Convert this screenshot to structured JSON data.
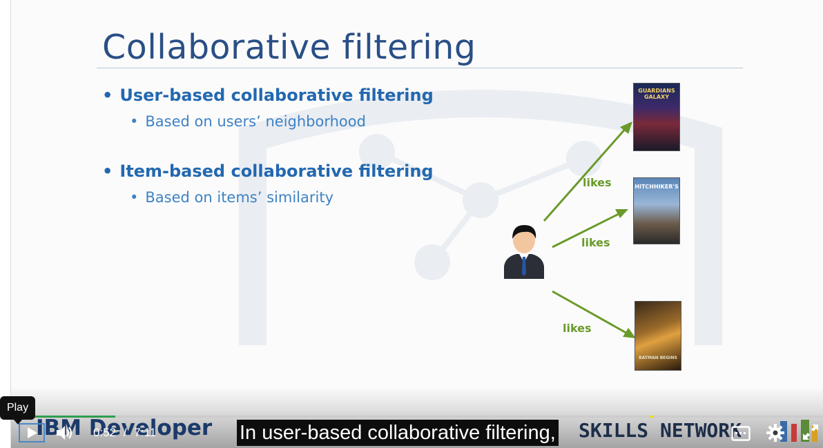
{
  "slide": {
    "title": "Collaborative filtering",
    "bullets": [
      {
        "level": 1,
        "text": "User-based collaborative filtering"
      },
      {
        "level": 2,
        "text": "Based on users’ neighborhood"
      },
      {
        "level": 1,
        "text": "Item-based collaborative filtering"
      },
      {
        "level": 2,
        "text": "Based on items’ similarity"
      }
    ],
    "arrow_labels": [
      "likes",
      "likes",
      "likes"
    ],
    "posters": [
      {
        "text": "GUARDIANS GALAXY",
        "icon": "movie-poster-icon"
      },
      {
        "text": "HITCHHIKER'S",
        "icon": "movie-poster-icon"
      },
      {
        "text": "BATMAN BEGINS",
        "icon": "movie-poster-icon"
      }
    ]
  },
  "player": {
    "tooltip": "Play",
    "current_time": "0:52",
    "separator": "/",
    "duration": "7:11",
    "progress": 0.128,
    "caption": "In user-based collaborative filtering,",
    "brand_left": "IBM Developer",
    "brand_right": "SKILLS NETWORK",
    "icons": {
      "play": "play-icon",
      "volume": "volume-icon",
      "captions": "closed-captions-icon",
      "settings": "gear-icon",
      "fullscreen": "fullscreen-icon"
    },
    "colors": {
      "progress": "#2e9e4e",
      "focus": "#4a86c8"
    }
  }
}
